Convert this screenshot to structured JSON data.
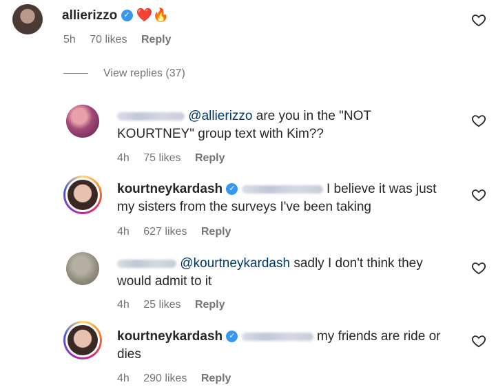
{
  "top_comment": {
    "username": "allierizzo",
    "emoji": "❤️🔥",
    "time": "5h",
    "likes": "70 likes",
    "reply": "Reply"
  },
  "view_replies": "View replies (37)",
  "replies": [
    {
      "mention": "@allierizzo",
      "text_line1": " are you in the \"NOT",
      "text_line2": "KOURTNEY\" group text with Kim??",
      "time": "4h",
      "likes": "75 likes",
      "reply": "Reply"
    },
    {
      "username": "kourtneykardash",
      "text_line1": " I believe it was just",
      "text_line2": "my sisters from the surveys I've been taking",
      "time": "4h",
      "likes": "627 likes",
      "reply": "Reply"
    },
    {
      "mention": "@kourtneykardash",
      "text_line1": " sadly I don't think they",
      "text_line2": "would admit to it",
      "time": "4h",
      "likes": "25 likes",
      "reply": "Reply"
    },
    {
      "username": "kourtneykardash",
      "text_line1": " my friends are ride or",
      "text_line2": "dies",
      "time": "4h",
      "likes": "290 likes",
      "reply": "Reply"
    }
  ]
}
